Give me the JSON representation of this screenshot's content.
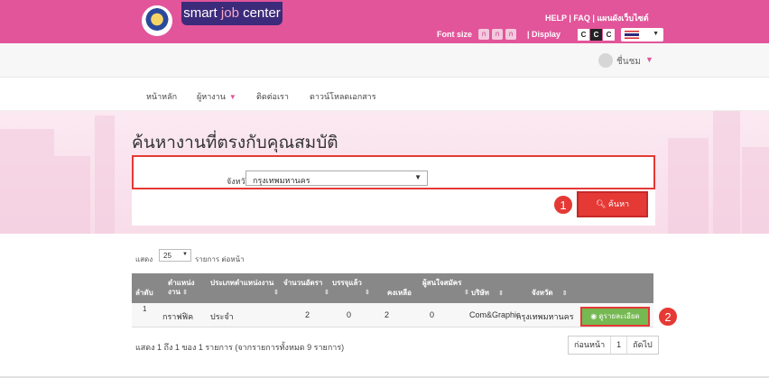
{
  "header": {
    "brand_part1": "smart ",
    "brand_part2": "job",
    "brand_part3": " center",
    "help_links": "HELP | FAQ | แผนผังเว็บไซต์",
    "font_size_label": "Font size",
    "font_buttons": [
      "ก",
      "ก",
      "ก"
    ],
    "display_label": "| Display",
    "display_buttons": [
      "C",
      "C",
      "C"
    ],
    "accent_color": "#e2559a"
  },
  "user": {
    "name": "ชื่นชม"
  },
  "nav": {
    "items": [
      "หน้าหลัก",
      "ผู้หางาน",
      "ติดต่อเรา",
      "ดาวน์โหลดเอกสาร"
    ]
  },
  "search": {
    "page_title": "ค้นหางานที่ตรงกับคุณสมบัติ",
    "province_label": "จังหวัด",
    "province_value": "กรุงเทพมหานคร",
    "search_button": "ค้นหา",
    "marker_1": "1",
    "marker_2": "2"
  },
  "table": {
    "show_label": "แสดง",
    "page_length": "25",
    "per_page_suffix": "รายการ ต่อหน้า",
    "headers": {
      "no": "ลำดับ",
      "position": "ตำแหน่ง งาน",
      "type": "ประเภทตำแหน่งงาน",
      "vacancies": "จำนวนอัตรา",
      "filled": "บรรจุแล้ว",
      "remaining": "คงเหลือ",
      "applicants": "ผู้สนใจสมัคร",
      "company": "บริษัท",
      "province": "จังหวัด"
    },
    "rows": [
      {
        "no": "1",
        "position": "กราฟฟิค",
        "type": "ประจำ",
        "vacancies": "2",
        "filled": "0",
        "remaining": "2",
        "applicants": "0",
        "company": "Com&Graphic",
        "province": "กรุงเทพมหานคร",
        "action": "ดูรายละเอียด"
      }
    ],
    "info": "แสดง 1 ถึง 1 ของ 1 รายการ (จากรายการทั้งหมด 9 รายการ)",
    "pager": {
      "prev": "ก่อนหน้า",
      "current": "1",
      "next": "ถัดไป"
    }
  }
}
